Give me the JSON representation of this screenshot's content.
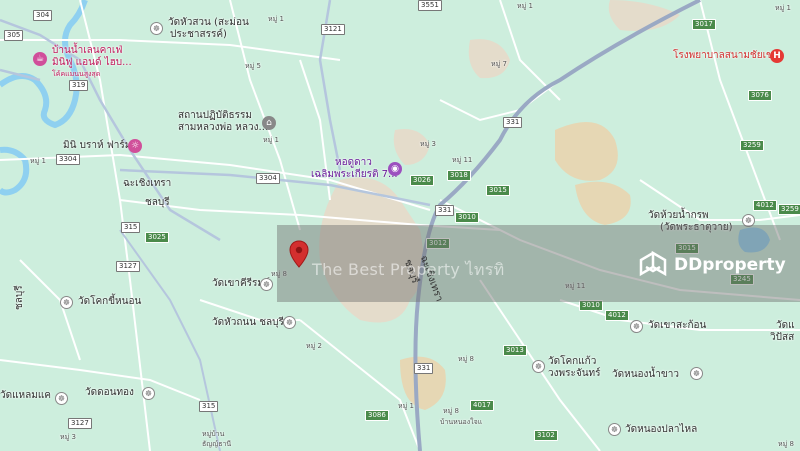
{
  "map": {
    "colors": {
      "land": "#cdeedd",
      "river": "#8fd0f0",
      "road_major": "#9aa9c4",
      "road_minor": "#ffffff",
      "urban": "#e4dccb",
      "sand": "#e6d7b4",
      "band": "#6e6e6e",
      "pin": "#d32f2f"
    },
    "labels": {
      "wat_hua_suan": "วัดหัวสวน (สะม่อน",
      "wat_hua_suan_2": "ประชาสรรค์)",
      "baan_nam": "บ้านน้ำเลนคาเฟ่",
      "baan_nam_2": "มินิฟู แอนด์ ไฮบ...",
      "baan_nam_3": "โค้คแมนนสูงสุด",
      "sathan": "สถานปฏิบัติธรรม",
      "sathan_2": "สามหลวงพ่อ หลวง...",
      "mini_farm": "มินิ บราห์ ฟาร์ม",
      "ho_doo_dao": "หอดูดาว",
      "ho_doo_dao_2": "เฉลิมพระเกียรติ 7...",
      "hospital": "โรงพยาบาลสนามชัยเขต",
      "cha_choeng": "ฉะเชิงเทรา",
      "chonburi": "ชลบุรี",
      "wat_huay": "วัดห้วยน้ำกรพ",
      "wat_huay_2": "(วัดพระธาตุวาย)",
      "wat_khao_khiri": "วัดเขาคีรีรมย์",
      "wat_kok_kee": "วัดโคกขี้หนอน",
      "wat_hua_thanon": "วัดหัวถนน ชลบุรี",
      "wat_don_thong": "วัดดอนทอง",
      "wat_lam_khae": "วัดแหลมแค",
      "wat_khao_sakaw": "วัดเขาสะก้อน",
      "wat_khok_kaew": "วัดโคกแก้ว",
      "wat_khok_kaew_2": "วงพระจันทร์",
      "wat_nong_nam_khao": "วัดหนองน้ำขาว",
      "wat_nong_pla_lai": "วัดหนองปลาไหล",
      "wat_right": "วัดแ",
      "wat_right_2": "วิปัสส",
      "chonburi_left": "ชลบุรี",
      "cha_choeng_rot": "ฉะเชิงเทรา",
      "chonburi_rot": "ชลบุรี",
      "baan_nong": "บ้านหนองใจแ",
      "moo_8_bottom": "หมู่ 8",
      "moo_2_bottom": "หมู่ 2",
      "moo_bottom_left": "หมู่บ้าน",
      "moo_bottom_left_2": "ธัญญ์ธานี"
    },
    "moo": {
      "m1": "หมู่ 1",
      "m2": "หมู่ 5",
      "m3": "หมู่ 1",
      "m4": "หมู่ 3",
      "m5": "หมู่ 11",
      "m6": "หมู่ 7",
      "m7": "หมู่ 8",
      "m8": "หมู่ 2",
      "m9": "หมู่ 11",
      "m10": "หมู่ 8",
      "m11": "หมู่ 1",
      "m12": "หมู่ 8",
      "m13": "หมู่ 1",
      "m14": "หมู่ 3",
      "m15": "หมู่ 1",
      "m16": "หมู่ 1",
      "m17": "หมู่ 8"
    },
    "roads": {
      "r304": "304",
      "r3121": "3121",
      "r3551": "3551",
      "r3017": "3017",
      "r3076": "3076",
      "r319": "319",
      "r331a": "331",
      "r331b": "331",
      "r331c": "331",
      "r3026": "3026",
      "r3018": "3018",
      "r3015": "3015",
      "r3010": "3010",
      "r3259": "3259",
      "r4012a": "4012",
      "r3304": "3304",
      "r315a": "315",
      "r3025": "3025",
      "r3012": "3012",
      "r3127a": "3127",
      "r3010b": "3010",
      "r4012b": "4012",
      "r3245": "3245",
      "r315b": "315",
      "r3013": "3013",
      "r3086": "3086",
      "r4017": "4017",
      "r3102": "3102",
      "r3127b": "3127",
      "r305": "305",
      "r3259b": "3259",
      "r3015b": "3015"
    },
    "overlay": {
      "watermark": "The Best Property ไทรทิ",
      "brand": "DDproperty"
    }
  }
}
